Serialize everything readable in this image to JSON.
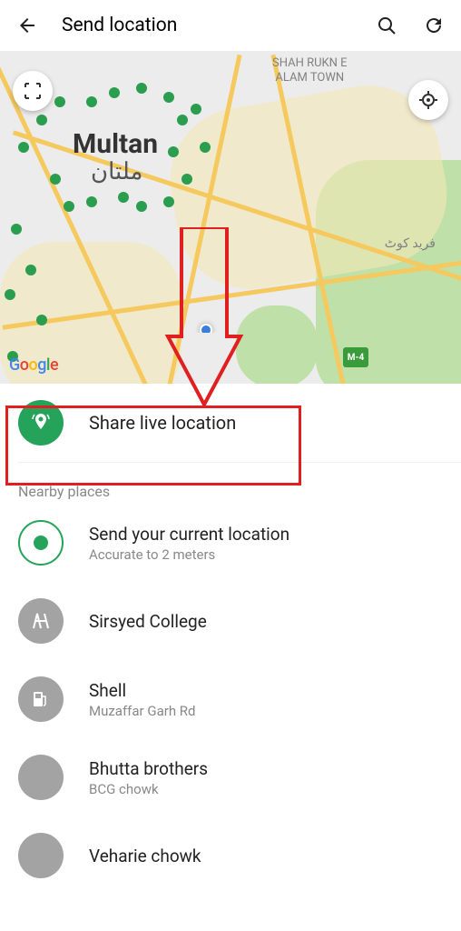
{
  "header": {
    "title": "Send location"
  },
  "map": {
    "city_name": "Multan",
    "city_name_local": "ملتان",
    "area_label_1_line1": "SHAH RUKN E",
    "area_label_1_line2": "ALAM TOWN",
    "area_label_2": "فرید کوٹ",
    "highway_shield": "M-4",
    "attribution": "Google"
  },
  "share_live": {
    "label": "Share live location"
  },
  "nearby_title": "Nearby places",
  "current": {
    "title": "Send your current location",
    "subtitle": "Accurate to 2 meters"
  },
  "places": [
    {
      "title": "Sirsyed College",
      "subtitle": ""
    },
    {
      "title": "Shell",
      "subtitle": "Muzaffar Garh Rd"
    },
    {
      "title": "Bhutta brothers",
      "subtitle": "BCG chowk"
    },
    {
      "title": "Veharie chowk",
      "subtitle": ""
    }
  ]
}
